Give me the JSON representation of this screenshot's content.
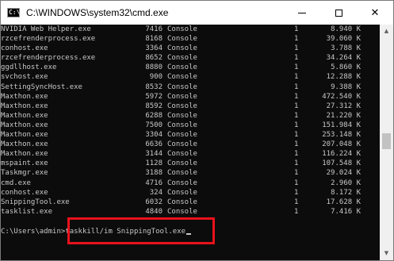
{
  "window": {
    "title": "C:\\WINDOWS\\system32\\cmd.exe",
    "icon_label": "C:\\",
    "minimize_glyph": "minimize-icon",
    "maximize_glyph": "maximize-icon",
    "close_label": "✕"
  },
  "console": {
    "processes": [
      {
        "name": "NVIDIA Web Helper.exe",
        "pid": "7416",
        "session": "Console",
        "num": "1",
        "mem": "8.940 K"
      },
      {
        "name": "rzcefrenderprocess.exe",
        "pid": "8168",
        "session": "Console",
        "num": "1",
        "mem": "39.060 K"
      },
      {
        "name": "conhost.exe",
        "pid": "3364",
        "session": "Console",
        "num": "1",
        "mem": "3.788 K"
      },
      {
        "name": "rzcefrenderprocess.exe",
        "pid": "8652",
        "session": "Console",
        "num": "1",
        "mem": "34.264 K"
      },
      {
        "name": "ggdllhost.exe",
        "pid": "8880",
        "session": "Console",
        "num": "1",
        "mem": "5.860 K"
      },
      {
        "name": "svchost.exe",
        "pid": "900",
        "session": "Console",
        "num": "1",
        "mem": "12.288 K"
      },
      {
        "name": "SettingSyncHost.exe",
        "pid": "8532",
        "session": "Console",
        "num": "1",
        "mem": "9.388 K"
      },
      {
        "name": "Maxthon.exe",
        "pid": "5972",
        "session": "Console",
        "num": "1",
        "mem": "472.540 K"
      },
      {
        "name": "Maxthon.exe",
        "pid": "8592",
        "session": "Console",
        "num": "1",
        "mem": "27.312 K"
      },
      {
        "name": "Maxthon.exe",
        "pid": "6288",
        "session": "Console",
        "num": "1",
        "mem": "21.220 K"
      },
      {
        "name": "Maxthon.exe",
        "pid": "7500",
        "session": "Console",
        "num": "1",
        "mem": "151.984 K"
      },
      {
        "name": "Maxthon.exe",
        "pid": "3304",
        "session": "Console",
        "num": "1",
        "mem": "253.148 K"
      },
      {
        "name": "Maxthon.exe",
        "pid": "6636",
        "session": "Console",
        "num": "1",
        "mem": "207.048 K"
      },
      {
        "name": "Maxthon.exe",
        "pid": "3144",
        "session": "Console",
        "num": "1",
        "mem": "116.224 K"
      },
      {
        "name": "mspaint.exe",
        "pid": "1128",
        "session": "Console",
        "num": "1",
        "mem": "107.548 K"
      },
      {
        "name": "Taskmgr.exe",
        "pid": "3188",
        "session": "Console",
        "num": "1",
        "mem": "29.024 K"
      },
      {
        "name": "cmd.exe",
        "pid": "4716",
        "session": "Console",
        "num": "1",
        "mem": "2.960 K"
      },
      {
        "name": "conhost.exe",
        "pid": "324",
        "session": "Console",
        "num": "1",
        "mem": "8.172 K"
      },
      {
        "name": "SnippingTool.exe",
        "pid": "6032",
        "session": "Console",
        "num": "1",
        "mem": "17.628 K"
      },
      {
        "name": "tasklist.exe",
        "pid": "4840",
        "session": "Console",
        "num": "1",
        "mem": "7.416 K"
      }
    ],
    "prompt": "C:\\Users\\admin>",
    "command": "taskkill/im SnippingTool.exe"
  },
  "colors": {
    "console_bg": "#0c0c0c",
    "console_text": "#c8c8c8",
    "highlight": "#e8121b"
  }
}
